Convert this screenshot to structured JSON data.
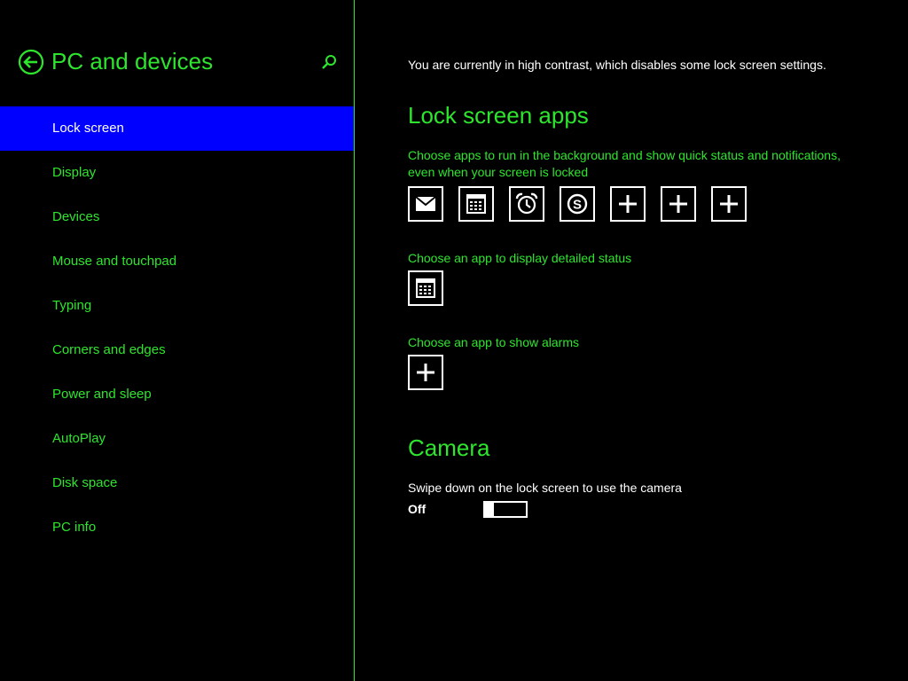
{
  "sidebar": {
    "title": "PC and devices",
    "back_icon": "back-arrow-icon",
    "search_icon": "search-icon",
    "items": [
      {
        "label": "Lock screen",
        "selected": true
      },
      {
        "label": "Display",
        "selected": false
      },
      {
        "label": "Devices",
        "selected": false
      },
      {
        "label": "Mouse and touchpad",
        "selected": false
      },
      {
        "label": "Typing",
        "selected": false
      },
      {
        "label": "Corners and edges",
        "selected": false
      },
      {
        "label": "Power and sleep",
        "selected": false
      },
      {
        "label": "AutoPlay",
        "selected": false
      },
      {
        "label": "Disk space",
        "selected": false
      },
      {
        "label": "PC info",
        "selected": false
      }
    ]
  },
  "main": {
    "high_contrast_notice": "You are currently in high contrast, which disables some lock screen settings.",
    "lock_screen_apps": {
      "heading": "Lock screen apps",
      "description_line1": "Choose apps to run in the background and show quick status and notifications,",
      "description_line2": "even when your screen is locked",
      "apps": [
        "mail-icon",
        "calendar-icon",
        "alarm-clock-icon",
        "skype-icon",
        "add-icon",
        "add-icon",
        "add-icon"
      ]
    },
    "detailed_status": {
      "label": "Choose an app to display detailed status",
      "app": "calendar-icon"
    },
    "alarms": {
      "label": "Choose an app to show alarms",
      "app": "add-icon"
    },
    "camera": {
      "heading": "Camera",
      "description": "Swipe down on the lock screen to use the camera",
      "toggle_state": "Off",
      "toggle_on": false
    }
  },
  "colors": {
    "background": "#000000",
    "accent_green": "#2ee52e",
    "selection_blue": "#0000ff",
    "text_white": "#ffffff"
  }
}
